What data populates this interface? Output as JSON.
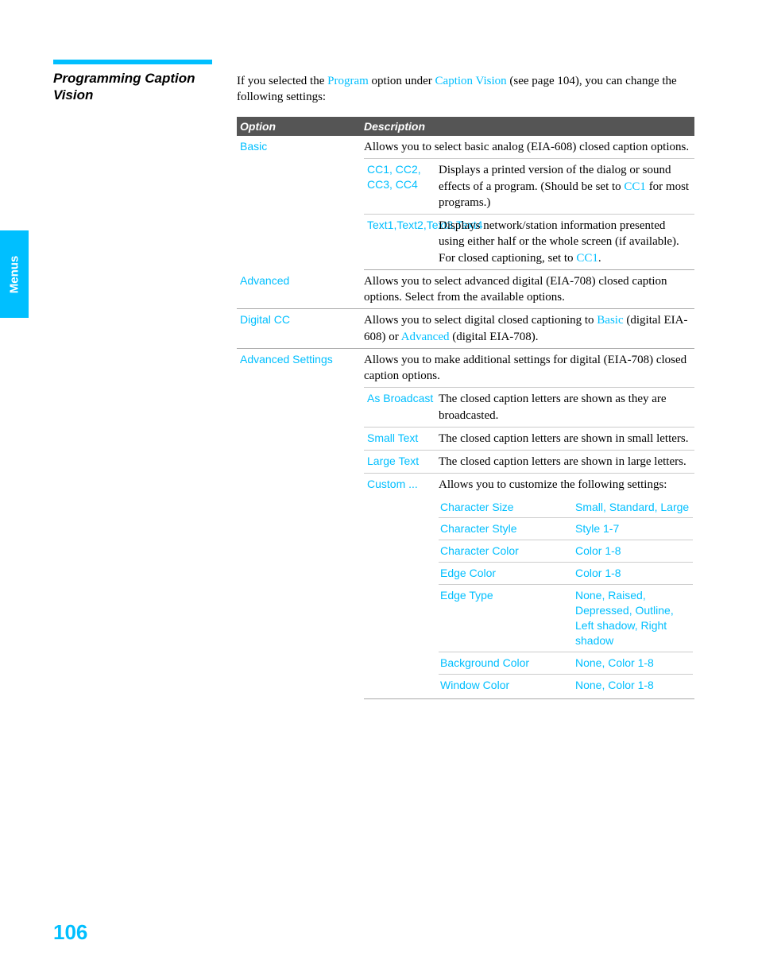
{
  "sideTab": "Menus",
  "sectionTitle": "Programming Caption Vision",
  "intro": {
    "pre": "If you selected the ",
    "link1": "Program",
    "mid1": " option under ",
    "link2": "Caption Vision",
    "post": " (see page 104), you can change the following settings:"
  },
  "headers": {
    "option": "Option",
    "description": "Description"
  },
  "basic": {
    "label": "Basic",
    "desc": "Allows you to select basic analog (EIA-608) closed caption options.",
    "cc": {
      "label": "CC1, CC2, CC3, CC4",
      "descPre": "Displays a printed version of the dialog or sound effects of a program. (Should be set to ",
      "cc1": "CC1",
      "descPost": " for most programs.)"
    },
    "text": {
      "label": "Text1,Text2,Text3,Text4",
      "descPre": "Displays network/station information presented using either half or the whole screen (if available). For closed captioning, set to ",
      "cc1": "CC1",
      "descPost": "."
    }
  },
  "advanced": {
    "label": "Advanced",
    "desc": "Allows you to select advanced digital (EIA-708) closed caption options. Select from the available options."
  },
  "digitalCC": {
    "label": "Digital CC",
    "descPre": "Allows you to select digital closed captioning to ",
    "link1": "Basic",
    "mid1": " (digital EIA-608) or ",
    "link2": "Advanced",
    "post": " (digital EIA-708)."
  },
  "advancedSettings": {
    "label": "Advanced Settings",
    "desc": "Allows you to make additional settings for digital (EIA-708) closed caption options.",
    "asBroadcast": {
      "label": "As Broadcast",
      "desc": "The closed caption letters are shown as they are broadcasted."
    },
    "smallText": {
      "label": "Small Text",
      "desc": "The closed caption letters are shown in small letters."
    },
    "largeText": {
      "label": "Large Text",
      "desc": "The closed caption letters are shown in large letters."
    },
    "custom": {
      "label": "Custom ...",
      "desc": "Allows you to customize the following settings:",
      "rows": [
        {
          "name": "Character Size",
          "value": "Small, Standard, Large"
        },
        {
          "name": "Character Style",
          "value": "Style 1-7"
        },
        {
          "name": "Character Color",
          "value": "Color 1-8"
        },
        {
          "name": "Edge Color",
          "value": "Color 1-8"
        },
        {
          "name": "Edge Type",
          "value": "None, Raised, Depressed, Outline, Left shadow, Right shadow"
        },
        {
          "name": "Background Color",
          "value": "None, Color 1-8"
        },
        {
          "name": "Window Color",
          "value": "None, Color 1-8"
        }
      ]
    }
  },
  "pageNumber": "106"
}
